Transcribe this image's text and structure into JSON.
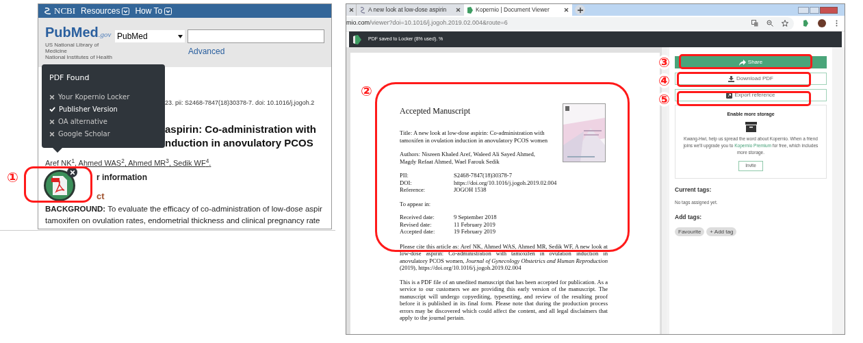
{
  "left_window": {
    "ncbi_bar": {
      "brand": "NCBI",
      "menus": [
        "Resources",
        "How To"
      ]
    },
    "pubmed_header": {
      "logo": "PubMed",
      "logo_suffix": ".gov",
      "org_lines": [
        "US National Library of Medicine",
        "National Institutes of Health"
      ],
      "database_select": "PubMed",
      "advanced_link": "Advanced"
    },
    "article": {
      "citation": "23. pii: S2468-7847(18)30378-7. doi: 10.1016/j.jogoh.2",
      "title_lines": [
        "aspirin: Co-administration with",
        "nduction in anovulatory PCOS"
      ],
      "authors": "Aref NK$^{1}$, Ahmed WAS$^{2}$, Ahmed MR$^{3}$, Sedik WF$^{4}$.",
      "author_info": "r information",
      "abstract_heading": "ct",
      "background_lines": [
        "**BACKGROUND:** To evaluate the efficacy of co-administration of low-dose aspir",
        "tamoxifen on ovulation rates, endometrial thickness and clinical pregnancy rate"
      ]
    },
    "popup": {
      "title": "PDF Found",
      "options": [
        {
          "label": "Your Kopernio Locker",
          "found": false
        },
        {
          "label": "Publisher Version",
          "found": true
        },
        {
          "label": "OA alternative",
          "found": false
        },
        {
          "label": "Google Scholar",
          "found": false
        }
      ]
    }
  },
  "right_window": {
    "tabs": [
      {
        "title": "A new look at low-dose aspirin",
        "selected": false
      },
      {
        "title": "Kopernio | Document Viewer",
        "selected": true
      }
    ],
    "address": {
      "host_part": "mio.com",
      "path_part": "/viewer?doi=10.1016/j.jogoh.2019.02.004&route=6"
    },
    "notice": "PDF saved to Locker (8% used). %",
    "pdf": {
      "heading": "Accepted Manuscript",
      "title_lines": [
        "Title: A new look at low-dose aspirin: Co-administration with",
        "tamoxifen in ovulation induction in anovulatory PCOS women"
      ],
      "author_lines": [
        "Authors: Nisreen Khaled Aref, Waleed Ali Sayed Ahmed,",
        "Magdy Refaat Ahmed, Wael Farouk Sedik"
      ],
      "identifiers": [
        {
          "label": "PII:",
          "value": "S2468-7847(18)30378-7"
        },
        {
          "label": "DOI:",
          "value": "https://doi.org/10.1016/j.jogoh.2019.02.004"
        },
        {
          "label": "Reference:",
          "value": "JOGOH 1538"
        }
      ],
      "appear": "To appear in:",
      "dates": [
        {
          "label": "Received date:",
          "value": "9 September 2018"
        },
        {
          "label": "Revised date:",
          "value": "11 February 2019"
        },
        {
          "label": "Accepted date:",
          "value": "19 February 2019"
        }
      ],
      "cite": "Please cite this article as: Aref NK, Ahmed WAS, Ahmed MR, Sedik WF, A new look at low-dose aspirin: Co-administration with tamoxifen in ovulation induction in anovulatory PCOS women, *Journal of Gynecology Obstetrics and Human Reproduction* (2019), https://doi.org/10.1016/j.jogoh.2019.02.004",
      "disclaimer": "This is a PDF file of an unedited manuscript that has been accepted for publication. As a service to our customers we are providing this early version of the manuscript. The manuscript will undergo copyediting, typesetting, and review of the resulting proof before it is published in its final form. Please note that during the production process errors may be discovered which could affect the content, and all legal disclaimers that apply to the journal pertain."
    },
    "actions": [
      {
        "label": "Share",
        "kind": "share"
      },
      {
        "label": "Download PDF",
        "kind": "download"
      },
      {
        "label": "Export reference",
        "kind": "export"
      }
    ],
    "storage_card": {
      "title": "Enable more storage",
      "text_before": "Kwang-Hwi, help us spread the word about Kopernio. When a friend joins we'll upgrade you to ",
      "link": "Kopernio Premium",
      "text_after": " for free, which includes more storage.",
      "button": "Invite"
    },
    "current_tags": {
      "heading": "Current tags:",
      "empty": "No tags assigned yet."
    },
    "add_tags": {
      "heading": "Add tags:",
      "tags": [
        "Favourite",
        "+ Add tag"
      ]
    }
  },
  "annotations": [
    {
      "label": "①"
    },
    {
      "label": "②"
    },
    {
      "label": "③"
    },
    {
      "label": "④"
    },
    {
      "label": "⑤"
    }
  ]
}
